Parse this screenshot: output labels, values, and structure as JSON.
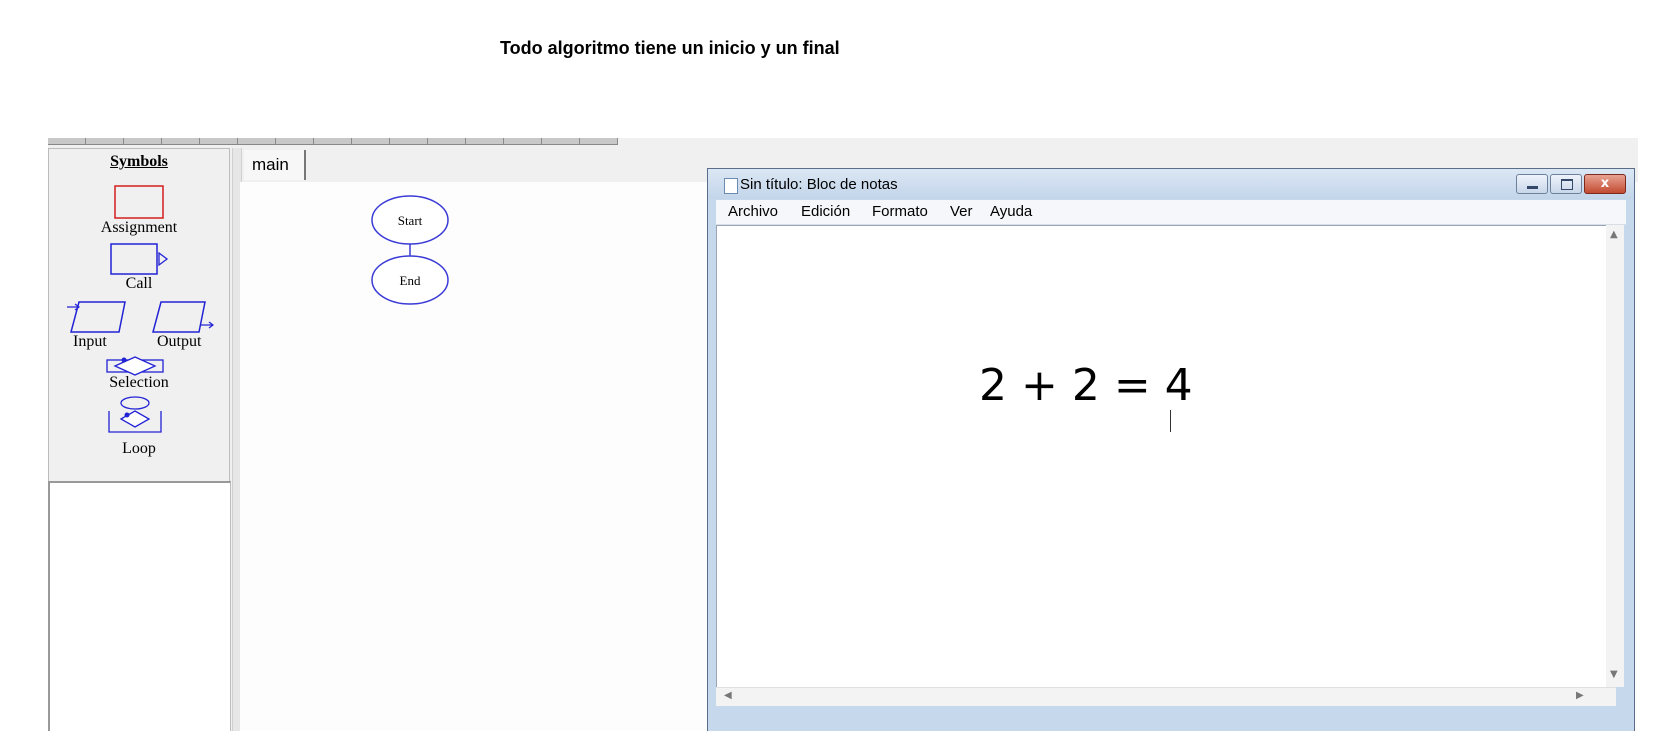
{
  "caption": "Todo algoritmo tiene un inicio y un final",
  "raptor": {
    "symbols_title": "Symbols",
    "symbols": {
      "assignment": "Assignment",
      "call": "Call",
      "input": "Input",
      "output": "Output",
      "selection": "Selection",
      "loop": "Loop"
    },
    "tab": "main",
    "flowchart": {
      "start": "Start",
      "end": "End"
    }
  },
  "notepad": {
    "title": "Sin título: Bloc de notas",
    "menu": [
      "Archivo",
      "Edición",
      "Formato",
      "Ver",
      "Ayuda"
    ],
    "content": "2 + 2 = 4",
    "close_label": "x"
  },
  "colors": {
    "symbol_stroke": "#2323d6",
    "assignment_stroke": "#d21e1e",
    "notepad_frame": "#c6d8ec"
  }
}
